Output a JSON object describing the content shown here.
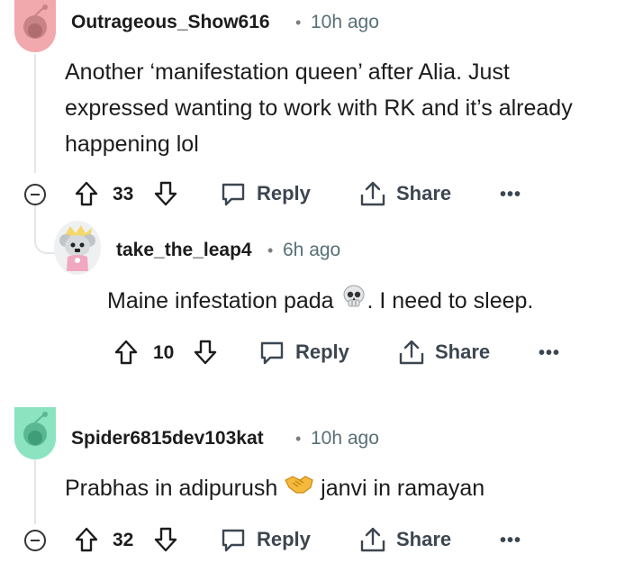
{
  "colors": {
    "avatar1_bg": "#f2a9ad",
    "avatar3_bg": "#8ce3c0",
    "thread_line": "#e3e6e8",
    "muted": "#576f76"
  },
  "comments": [
    {
      "username": "Outrageous_Show616",
      "separator": "•",
      "time": "10h ago",
      "body_lines": [
        "Another ‘manifestation queen’ after Alia. Just",
        "expressed wanting to work with RK and it’s already",
        "happening lol"
      ],
      "votes": "33",
      "reply_label": "Reply",
      "share_label": "Share",
      "more_label": "•••"
    },
    {
      "username": "take_the_leap4",
      "separator": "•",
      "time": "6h ago",
      "body_before": "Maine infestation pada ",
      "body_emoji": "skull-emoji",
      "body_after": ". I need to sleep.",
      "votes": "10",
      "reply_label": "Reply",
      "share_label": "Share",
      "more_label": "•••"
    },
    {
      "username": "Spider6815dev103kat",
      "separator": "•",
      "time": "10h ago",
      "body_before": "Prabhas in adipurush ",
      "body_emoji": "handshake-emoji",
      "body_after": " janvi in ramayan",
      "votes": "32",
      "reply_label": "Reply",
      "share_label": "Share",
      "more_label": "•••"
    }
  ]
}
